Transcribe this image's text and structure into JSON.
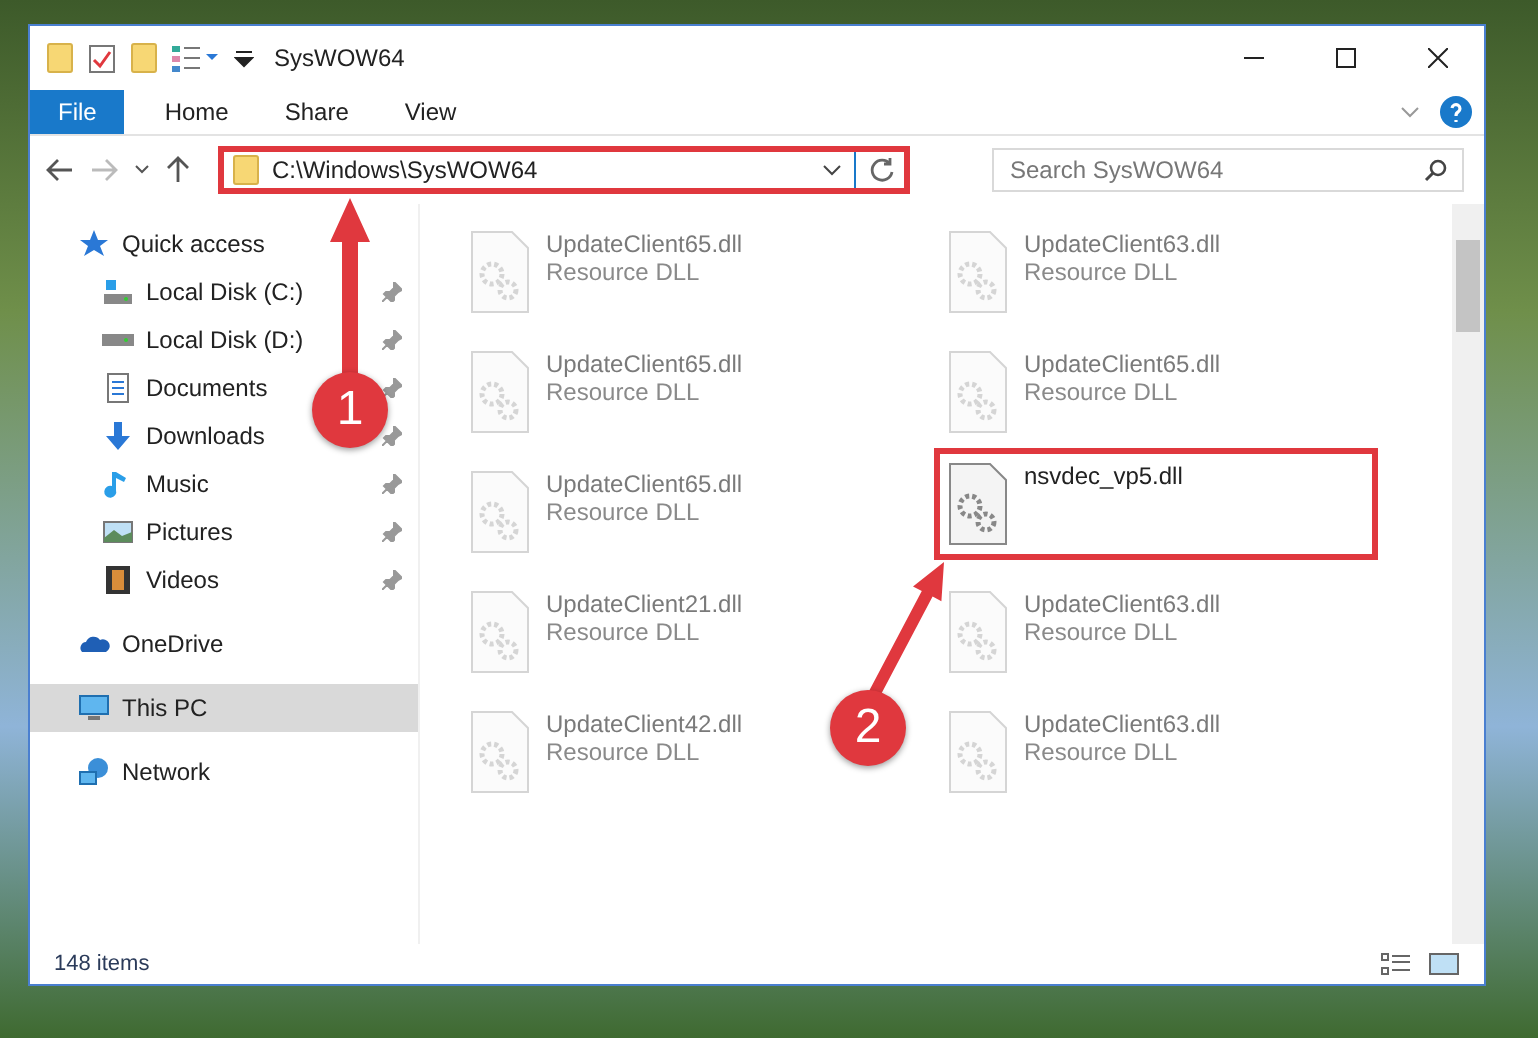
{
  "window": {
    "title": "SysWOW64"
  },
  "ribbon_tabs": [
    {
      "label": "File",
      "selected": true
    },
    {
      "label": "Home",
      "selected": false
    },
    {
      "label": "Share",
      "selected": false
    },
    {
      "label": "View",
      "selected": false
    }
  ],
  "address": {
    "path": "C:\\Windows\\SysWOW64",
    "highlighted": true
  },
  "search": {
    "placeholder": "Search SysWOW64"
  },
  "sidebar": {
    "items": [
      {
        "label": "Quick access",
        "kind": "star",
        "selected": false,
        "children": [
          {
            "label": "Local Disk (C:)",
            "kind": "system-drive",
            "pinned": true,
            "selected": false
          },
          {
            "label": "Local Disk (D:)",
            "kind": "drive",
            "pinned": true,
            "selected": false
          },
          {
            "label": "Documents",
            "kind": "document",
            "pinned": true,
            "selected": false
          },
          {
            "label": "Downloads",
            "kind": "download",
            "pinned": true,
            "selected": false
          },
          {
            "label": "Music",
            "kind": "music",
            "pinned": true,
            "selected": false
          },
          {
            "label": "Pictures",
            "kind": "picture",
            "pinned": true,
            "selected": false
          },
          {
            "label": "Videos",
            "kind": "video",
            "pinned": true,
            "selected": false
          }
        ]
      },
      {
        "label": "OneDrive",
        "kind": "cloud",
        "selected": false
      },
      {
        "label": "This PC",
        "kind": "computer",
        "selected": true
      },
      {
        "label": "Network",
        "kind": "network",
        "selected": false
      }
    ]
  },
  "files": [
    {
      "name": "UpdateClient65.dll",
      "type": "Resource DLL",
      "blurred": true,
      "highlighted": false
    },
    {
      "name": "UpdateClient63.dll",
      "type": "Resource DLL",
      "blurred": true,
      "highlighted": false
    },
    {
      "name": "UpdateClient65.dll",
      "type": "Resource DLL",
      "blurred": true,
      "highlighted": false
    },
    {
      "name": "UpdateClient65.dll",
      "type": "Resource DLL",
      "blurred": true,
      "highlighted": false
    },
    {
      "name": "UpdateClient65.dll",
      "type": "Resource DLL",
      "blurred": true,
      "highlighted": false
    },
    {
      "name": "nsvdec_vp5.dll",
      "blurred": false,
      "highlighted": true
    },
    {
      "name": "UpdateClient21.dll",
      "type": "Resource DLL",
      "blurred": true,
      "highlighted": false
    },
    {
      "name": "UpdateClient63.dll",
      "type": "Resource DLL",
      "blurred": true,
      "highlighted": false
    },
    {
      "name": "UpdateClient42.dll",
      "type": "Resource DLL",
      "blurred": true,
      "highlighted": false
    },
    {
      "name": "UpdateClient63.dll",
      "type": "Resource DLL",
      "blurred": true,
      "highlighted": false
    }
  ],
  "status_bar": {
    "count": "148 items"
  },
  "annotations": [
    {
      "label": "1"
    },
    {
      "label": "2"
    }
  ]
}
